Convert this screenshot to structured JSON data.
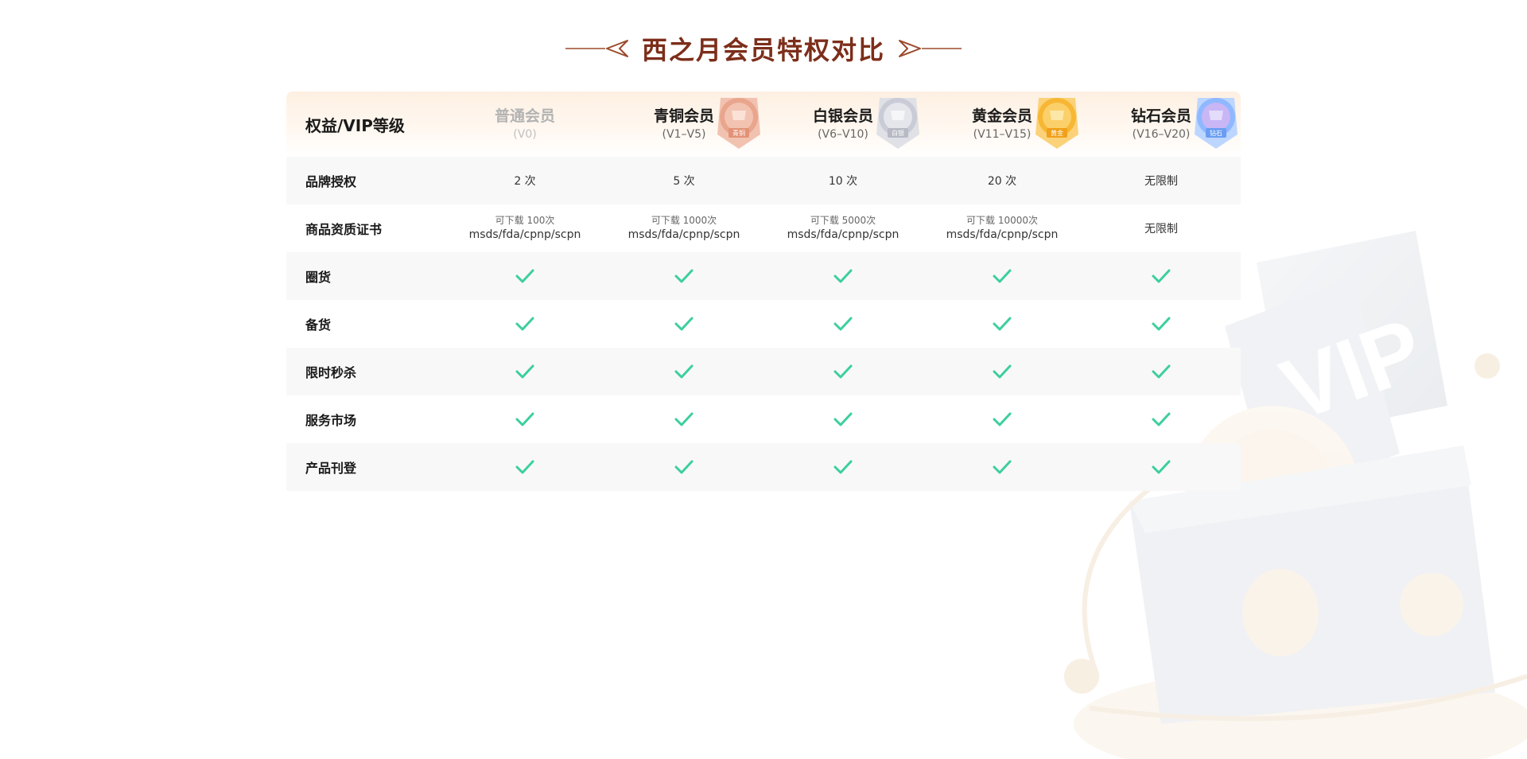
{
  "title": "西之月会员特权对比",
  "colors": {
    "title": "#7c2e1a",
    "check": "#3ccf9c",
    "bronze": "#e9a58d",
    "silver": "#c9ccd6",
    "gold": "#f7b733",
    "diamond": "#8fb8ff"
  },
  "header": {
    "label": "权益/VIP等级",
    "tiers": [
      {
        "name": "普通会员",
        "range": "(V0)",
        "badge": ""
      },
      {
        "name": "青铜会员",
        "range": "(V1–V5)",
        "badge": "青铜"
      },
      {
        "name": "白银会员",
        "range": "(V6–V10)",
        "badge": "白银"
      },
      {
        "name": "黄金会员",
        "range": "(V11–V15)",
        "badge": "黄金"
      },
      {
        "name": "钻石会员",
        "range": "(V16–V20)",
        "badge": "钻石"
      }
    ]
  },
  "rows": {
    "brand": {
      "label": "品牌授权",
      "values": [
        "2 次",
        "5 次",
        "10 次",
        "20 次",
        "无限制"
      ]
    },
    "cert": {
      "label": "商品资质证书",
      "values": [
        {
          "top": "可下载 100次",
          "bottom": "msds/fda/cpnp/scpn"
        },
        {
          "top": "可下载 1000次",
          "bottom": "msds/fda/cpnp/scpn"
        },
        {
          "top": "可下载 5000次",
          "bottom": "msds/fda/cpnp/scpn"
        },
        {
          "top": "可下载 10000次",
          "bottom": "msds/fda/cpnp/scpn"
        }
      ],
      "last": "无限制"
    },
    "check_rows": [
      {
        "label": "圈货"
      },
      {
        "label": "备货"
      },
      {
        "label": "限时秒杀"
      },
      {
        "label": "服务市场"
      },
      {
        "label": "产品刊登"
      }
    ]
  },
  "icons": {
    "check": "check-icon",
    "ornament": "arrow-ornament-icon",
    "badge": "medal-badge-icon",
    "deco": "vip-illustration-icon"
  }
}
